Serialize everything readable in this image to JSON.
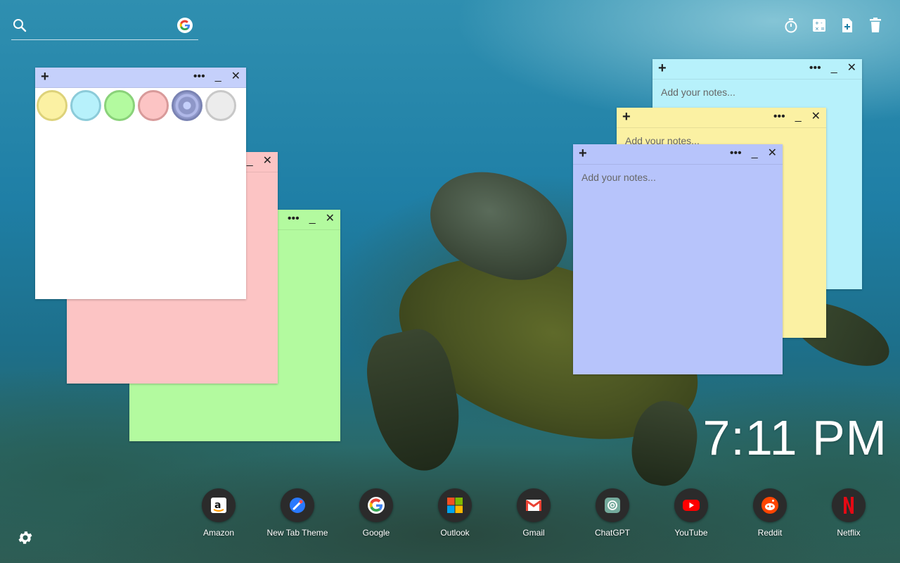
{
  "search": {
    "placeholder": ""
  },
  "clock": {
    "time": "7:11 PM"
  },
  "note_placeholder": "Add your notes...",
  "note_controls": {
    "add": "+",
    "more": "•••",
    "minimize": "_",
    "close": "✕"
  },
  "colors": {
    "note_blue": "#b7c4fb",
    "note_cyan": "#b7f1fb",
    "note_yellow": "#fbf1a3",
    "note_pink": "#fcc4c4",
    "note_green": "#b3fa9f",
    "note_white": "#ffffff",
    "note_header_white": "#c5d0fb"
  },
  "palette": [
    "#fbf1a3",
    "#b7f1fb",
    "#b3fa9f",
    "#fcc4c4",
    "#8e97c8",
    "#ececec"
  ],
  "dock": [
    {
      "label": "Amazon",
      "icon": "amazon-icon"
    },
    {
      "label": "New Tab Theme",
      "icon": "new-tab-theme-icon"
    },
    {
      "label": "Google",
      "icon": "google-icon"
    },
    {
      "label": "Outlook",
      "icon": "outlook-icon"
    },
    {
      "label": "Gmail",
      "icon": "gmail-icon"
    },
    {
      "label": "ChatGPT",
      "icon": "chatgpt-icon"
    },
    {
      "label": "YouTube",
      "icon": "youtube-icon"
    },
    {
      "label": "Reddit",
      "icon": "reddit-icon"
    },
    {
      "label": "Netflix",
      "icon": "netflix-icon"
    }
  ]
}
